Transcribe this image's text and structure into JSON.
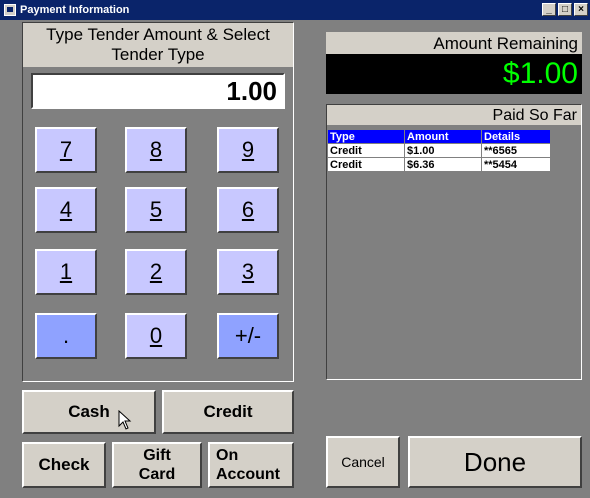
{
  "window": {
    "title": "Payment Information"
  },
  "prompt": {
    "line1": "Type Tender Amount & Select",
    "line2": "Tender Type"
  },
  "amount_input": {
    "value": "1.00"
  },
  "keypad": [
    "7",
    "8",
    "9",
    "4",
    "5",
    "6",
    "1",
    "2",
    "3",
    ".",
    "0",
    "+/-"
  ],
  "tender_buttons": {
    "cash": "Cash",
    "credit": "Credit",
    "check": "Check",
    "gift_card_line1": "Gift",
    "gift_card_line2": "Card",
    "on_account_line1": "On",
    "on_account_line2": "Account"
  },
  "amount_remaining": {
    "label": "Amount Remaining",
    "value": "$1.00"
  },
  "paid_so_far": {
    "label": "Paid So Far",
    "columns": [
      "Type",
      "Amount",
      "Details"
    ],
    "rows": [
      [
        "Credit",
        "$1.00",
        "**6565"
      ],
      [
        "Credit",
        "$6.36",
        "**5454"
      ]
    ]
  },
  "actions": {
    "cancel": "Cancel",
    "done": "Done"
  },
  "colors": {
    "title_bar": "#0a246a",
    "keypad": "#c8c8ff",
    "keypad_alt": "#8fa2ff",
    "remaining_text": "#00ff00",
    "table_header": "#0000ff"
  }
}
